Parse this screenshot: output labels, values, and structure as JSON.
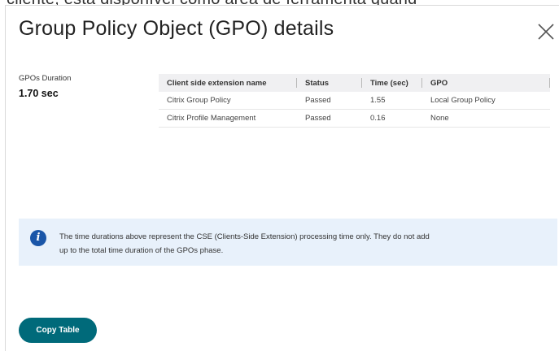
{
  "background": {
    "partial_text": "cliente, está disponível como área de ferramenta quand"
  },
  "dialog": {
    "title": "Group Policy Object (GPO) details",
    "close_icon": "close-icon"
  },
  "summary": {
    "label": "GPOs Duration",
    "value": "1.70 sec"
  },
  "table": {
    "columns": [
      "Client side extension name",
      "Status",
      "Time (sec)",
      "GPO"
    ],
    "rows": [
      [
        "Citrix Group Policy",
        "Passed",
        "1.55",
        "Local Group Policy"
      ],
      [
        "Citrix Profile Management",
        "Passed",
        "0.16",
        "None"
      ]
    ]
  },
  "info": {
    "icon": "info-icon",
    "text_line1": "The time durations above represent the CSE (Clients-Side Extension) processing time only. They do not add",
    "text_line2": "up to the total time duration of the GPOs phase."
  },
  "actions": {
    "copy_label": "Copy Table"
  },
  "colors": {
    "accent": "#006a7a",
    "info_bg": "#e8f1fb",
    "info_icon": "#1a56a8",
    "header_bg": "#f0f0f2"
  }
}
